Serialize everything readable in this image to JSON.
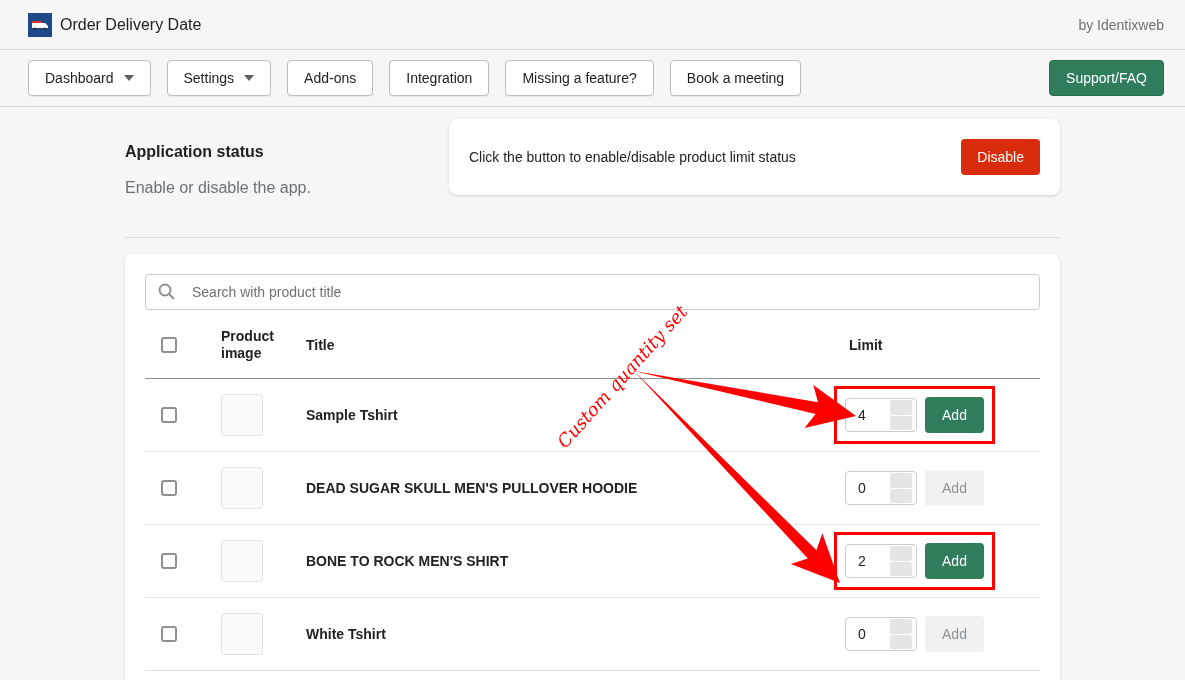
{
  "app_bar": {
    "title": "Order Delivery Date",
    "vendor": "by Identixweb"
  },
  "nav": {
    "buttons": [
      {
        "label": "Dashboard",
        "kind": "dropdown"
      },
      {
        "label": "Settings",
        "kind": "dropdown"
      },
      {
        "label": "Add-ons",
        "kind": "plain"
      },
      {
        "label": "Integration",
        "kind": "plain"
      },
      {
        "label": "Missing a feature?",
        "kind": "plain"
      },
      {
        "label": "Book a meeting",
        "kind": "plain"
      }
    ],
    "support_button": "Support/FAQ"
  },
  "application_status": {
    "heading": "Application status",
    "description": "Enable or disable the app.",
    "card_text": "Click the button to enable/disable product limit status",
    "button": "Disable"
  },
  "table": {
    "search": {
      "placeholder": "Search with product title"
    },
    "select_all_checked": false,
    "columns": [
      "Product image",
      "Title",
      "Limit"
    ],
    "rows": [
      {
        "title": "Sample Tshirt",
        "checked": false,
        "limit": "4",
        "add_label": "Add",
        "disabled": false,
        "highlighted": true
      },
      {
        "title": "DEAD SUGAR SKULL MEN'S PULLOVER HOODIE",
        "checked": false,
        "limit": "0",
        "add_label": "Add",
        "disabled": true,
        "highlighted": false
      },
      {
        "title": "BONE TO ROCK MEN'S SHIRT",
        "checked": false,
        "limit": "2",
        "add_label": "Add",
        "disabled": false,
        "highlighted": true
      },
      {
        "title": "White Tshirt",
        "checked": false,
        "limit": "0",
        "add_label": "Add",
        "disabled": true,
        "highlighted": false
      }
    ]
  },
  "annotation": {
    "text": "Custom quantity set"
  }
}
